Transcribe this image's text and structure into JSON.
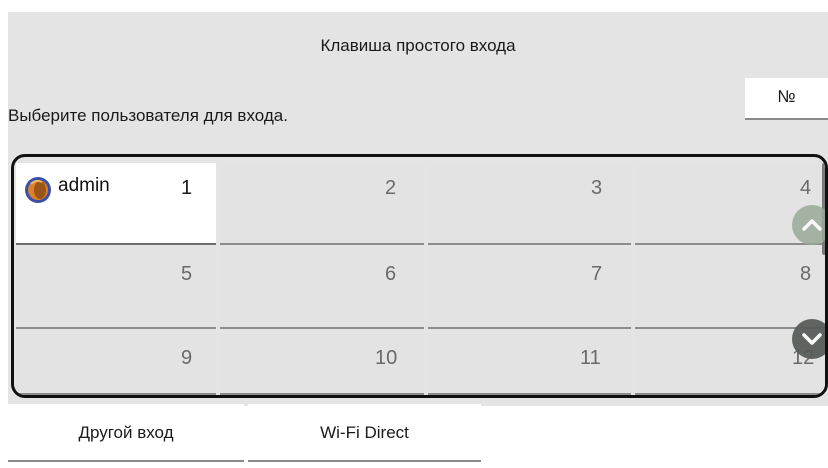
{
  "header": {
    "title": "Клавиша простого входа",
    "instruction": "Выберите пользователя для входа.",
    "number_button_label": "№"
  },
  "grid": {
    "cells": [
      {
        "number": "1",
        "user": "admin",
        "selected": true
      },
      {
        "number": "2",
        "user": ""
      },
      {
        "number": "3",
        "user": ""
      },
      {
        "number": "4",
        "user": ""
      },
      {
        "number": "5",
        "user": ""
      },
      {
        "number": "6",
        "user": ""
      },
      {
        "number": "7",
        "user": ""
      },
      {
        "number": "8",
        "user": ""
      },
      {
        "number": "9",
        "user": ""
      },
      {
        "number": "10",
        "user": ""
      },
      {
        "number": "11",
        "user": ""
      },
      {
        "number": "12",
        "user": ""
      }
    ],
    "scroll_up_icon": "chevron-up-icon",
    "scroll_down_icon": "chevron-down-icon"
  },
  "footer": {
    "other_login_label": "Другой вход",
    "wifi_direct_label": "Wi-Fi Direct"
  },
  "colors": {
    "panel_bg": "#e4e4e4",
    "selected_cell_bg": "#ffffff",
    "frame_border": "#111111"
  }
}
